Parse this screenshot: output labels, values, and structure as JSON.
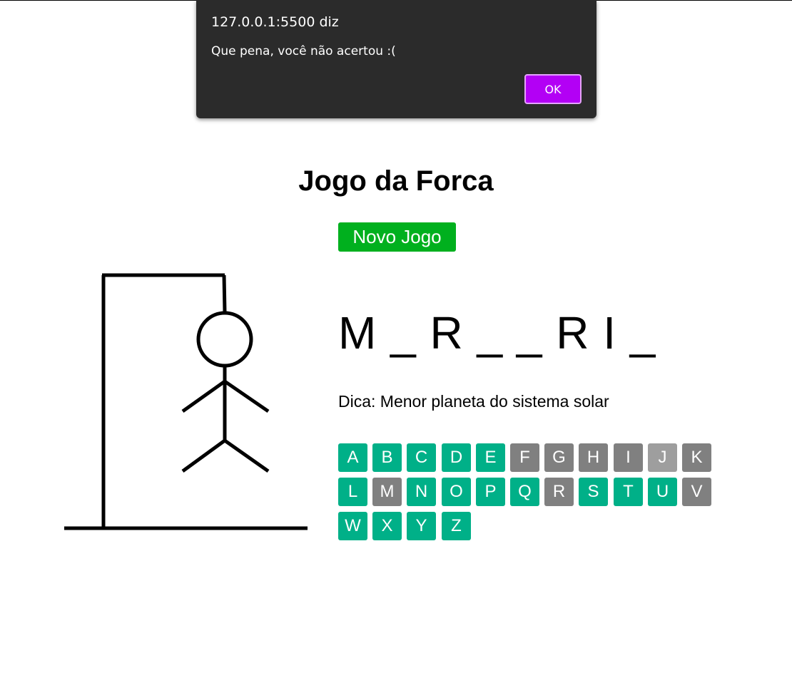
{
  "dialog": {
    "origin": "127.0.0.1:5500 diz",
    "message": "Que pena, você não acertou :(",
    "ok_label": "OK"
  },
  "page": {
    "title": "Jogo da Forca",
    "new_game_label": "Novo Jogo",
    "word_display": "M _ R _ _ R I _",
    "hint": "Dica: Menor planeta do sistema solar"
  },
  "colors": {
    "dialog_bg": "#2b2b2b",
    "ok_button": "#b300f5",
    "new_game_button": "#00b01e",
    "key_available": "#00b088",
    "key_used": "#808080"
  },
  "keyboard": [
    {
      "letter": "A",
      "state": "available"
    },
    {
      "letter": "B",
      "state": "available"
    },
    {
      "letter": "C",
      "state": "available"
    },
    {
      "letter": "D",
      "state": "available"
    },
    {
      "letter": "E",
      "state": "available"
    },
    {
      "letter": "F",
      "state": "used"
    },
    {
      "letter": "G",
      "state": "used"
    },
    {
      "letter": "H",
      "state": "used"
    },
    {
      "letter": "I",
      "state": "used"
    },
    {
      "letter": "J",
      "state": "used-light"
    },
    {
      "letter": "K",
      "state": "used"
    },
    {
      "letter": "L",
      "state": "available"
    },
    {
      "letter": "M",
      "state": "used"
    },
    {
      "letter": "N",
      "state": "available"
    },
    {
      "letter": "O",
      "state": "available"
    },
    {
      "letter": "P",
      "state": "available"
    },
    {
      "letter": "Q",
      "state": "available"
    },
    {
      "letter": "R",
      "state": "used"
    },
    {
      "letter": "S",
      "state": "available"
    },
    {
      "letter": "T",
      "state": "available"
    },
    {
      "letter": "U",
      "state": "available"
    },
    {
      "letter": "V",
      "state": "used"
    },
    {
      "letter": "W",
      "state": "available"
    },
    {
      "letter": "X",
      "state": "available"
    },
    {
      "letter": "Y",
      "state": "available"
    },
    {
      "letter": "Z",
      "state": "available"
    }
  ]
}
